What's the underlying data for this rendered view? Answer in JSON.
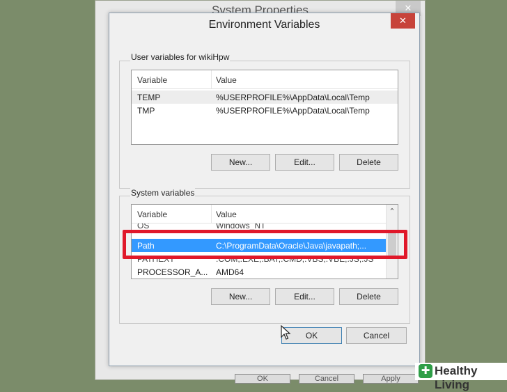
{
  "background_window": {
    "title": "System Properties",
    "close_glyph": "✕",
    "buttons": [
      "OK",
      "Cancel",
      "Apply"
    ]
  },
  "dialog": {
    "title": "Environment Variables",
    "close_glyph": "✕"
  },
  "user_vars": {
    "label": "User variables for wikiHpw",
    "columns": [
      "Variable",
      "Value"
    ],
    "rows": [
      {
        "variable": "TEMP",
        "value": "%USERPROFILE%\\AppData\\Local\\Temp"
      },
      {
        "variable": "TMP",
        "value": "%USERPROFILE%\\AppData\\Local\\Temp"
      }
    ],
    "buttons": {
      "new": "New...",
      "edit": "Edit...",
      "delete": "Delete"
    }
  },
  "system_vars": {
    "label": "System variables",
    "columns": [
      "Variable",
      "Value"
    ],
    "rows": [
      {
        "variable": "OS",
        "value": "Windows_NT"
      },
      {
        "variable": "Path",
        "value": "C:\\ProgramData\\Oracle\\Java\\javapath;..."
      },
      {
        "variable": "PATHEXT",
        "value": ".COM;.EXE;.BAT;.CMD;.VBS;.VBE;.JS;.JS"
      },
      {
        "variable": "PROCESSOR_A...",
        "value": "AMD64"
      }
    ],
    "selected_row": "Path",
    "scroll_up_glyph": "⌃",
    "buttons": {
      "new": "New...",
      "edit": "Edit...",
      "delete": "Delete"
    }
  },
  "footer": {
    "ok": "OK",
    "cancel": "Cancel"
  },
  "watermark": {
    "icon_glyph": "✚",
    "text": "Healthy Living"
  },
  "colors": {
    "highlight": "#e0182a",
    "selection": "#3399ff",
    "close": "#c7433a"
  }
}
